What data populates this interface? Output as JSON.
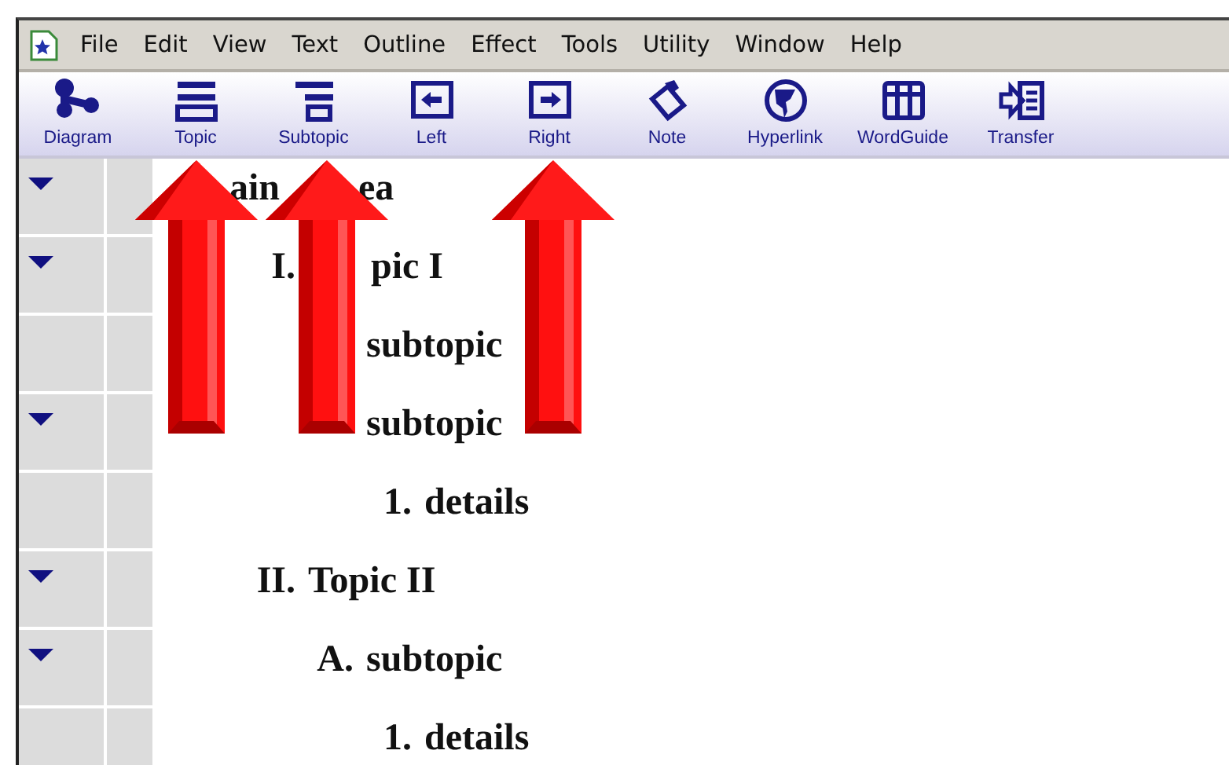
{
  "menu_bar": {
    "items": [
      "File",
      "Edit",
      "View",
      "Text",
      "Outline",
      "Effect",
      "Tools",
      "Utility",
      "Window",
      "Help"
    ]
  },
  "toolbar": {
    "buttons": [
      {
        "label": "Diagram",
        "kind": "diagram"
      },
      {
        "label": "Topic",
        "kind": "topic"
      },
      {
        "label": "Subtopic",
        "kind": "subtopic"
      },
      {
        "label": "Left",
        "kind": "left"
      },
      {
        "label": "Right",
        "kind": "right"
      },
      {
        "label": "Note",
        "kind": "note"
      },
      {
        "label": "Hyperlink",
        "kind": "hyperlink"
      },
      {
        "label": "WordGuide",
        "kind": "wordguide"
      },
      {
        "label": "Transfer",
        "kind": "transfer"
      }
    ]
  },
  "outline": {
    "items": [
      {
        "parts": [
          "ain",
          "ea"
        ],
        "expanded": true,
        "children": [
          {
            "label": "I.",
            "parts": [
              "pic I"
            ],
            "expanded": true,
            "children": [
              {
                "text": "subtopic"
              },
              {
                "text": "subtopic",
                "expanded": true,
                "children": [
                  {
                    "label": "1.",
                    "text": "details"
                  }
                ]
              }
            ]
          },
          {
            "label": "II.",
            "text": "Topic II",
            "expanded": true,
            "children": [
              {
                "label": "A.",
                "text": "subtopic",
                "expanded": true,
                "children": [
                  {
                    "label": "1.",
                    "text": "details"
                  }
                ]
              }
            ]
          }
        ]
      }
    ]
  }
}
